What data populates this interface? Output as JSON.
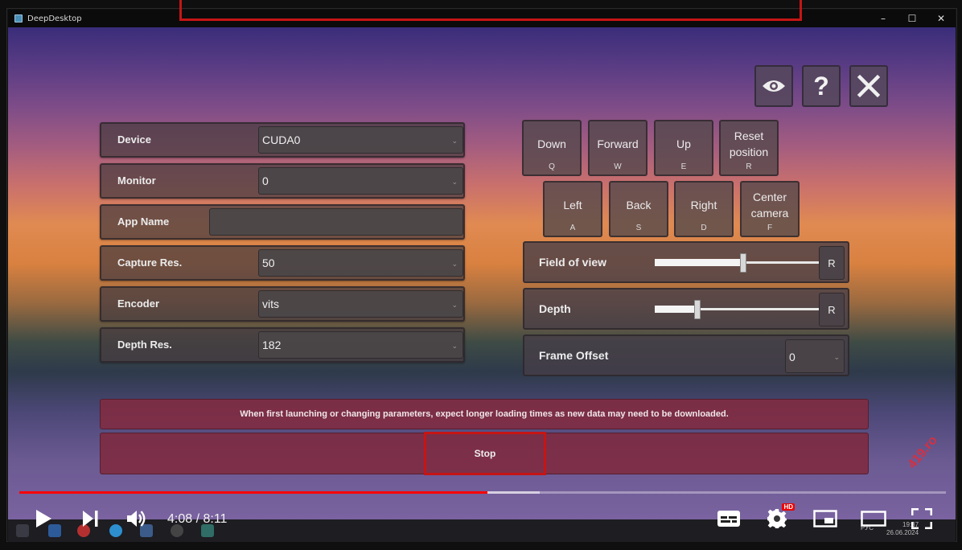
{
  "window": {
    "title": "DeepDesktop",
    "min": "–",
    "max": "☐",
    "close": "✕"
  },
  "top_icons": {
    "eye": "eye-icon",
    "help": "?",
    "close": "✕"
  },
  "settings": [
    {
      "label": "Device",
      "value": "CUDA0",
      "dropdown": true
    },
    {
      "label": "Monitor",
      "value": "0",
      "dropdown": true
    },
    {
      "label": "App Name",
      "value": "",
      "dropdown": false
    },
    {
      "label": "Capture Res.",
      "value": "50",
      "dropdown": true
    },
    {
      "label": "Encoder",
      "value": "vits",
      "dropdown": true
    },
    {
      "label": "Depth Res.",
      "value": "182",
      "dropdown": true
    }
  ],
  "keys": [
    {
      "label": "Down",
      "hotkey": "Q"
    },
    {
      "label": "Forward",
      "hotkey": "W"
    },
    {
      "label": "Up",
      "hotkey": "E"
    },
    {
      "label": "Reset position",
      "hotkey": "R"
    },
    {
      "label": "Left",
      "hotkey": "A"
    },
    {
      "label": "Back",
      "hotkey": "S"
    },
    {
      "label": "Right",
      "hotkey": "D"
    },
    {
      "label": "Center camera",
      "hotkey": "F"
    }
  ],
  "sliders": {
    "fov": {
      "label": "Field of view",
      "reset": "R",
      "level": 0.54
    },
    "depth": {
      "label": "Depth",
      "reset": "R",
      "level": 0.26
    }
  },
  "frame_offset": {
    "label": "Frame Offset",
    "value": "0"
  },
  "notice": "When first launching or changing parameters, expect longer loading times as new data may need to be downloaded.",
  "stop_label": "Stop",
  "watermark": "419.ro",
  "player": {
    "time": "4:08 / 8:11",
    "played": 0.505,
    "buffered": 0.562,
    "hd_badge": "HD"
  },
  "system_tray": {
    "lang": "РУС",
    "clock": "19:37",
    "date": "26.06.2024"
  },
  "colors": {
    "progress": "#ff0000",
    "notice_bg": "#842a3e",
    "highlight": "#c51515"
  }
}
